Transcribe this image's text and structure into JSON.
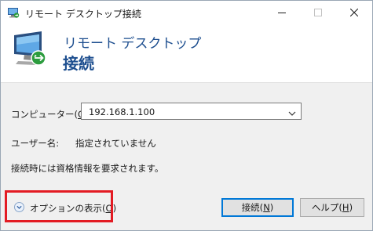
{
  "window": {
    "title": "リモート デスクトップ接続"
  },
  "banner": {
    "line1": "リモート デスクトップ",
    "line2": "接続"
  },
  "form": {
    "computer_label_pre": "コンピューター(",
    "computer_label_key": "C",
    "computer_label_post": "):",
    "computer_value": "192.168.1.100",
    "user_label": "ユーザー名:",
    "user_value": "指定されていません",
    "credentials_note": "接続時には資格情報を要求されます。"
  },
  "options": {
    "label_pre": "オプションの表示(",
    "label_key": "O",
    "label_post": ")"
  },
  "buttons": {
    "connect_pre": "接続(",
    "connect_key": "N",
    "connect_post": ")",
    "help_pre": "ヘルプ(",
    "help_key": "H",
    "help_post": ")"
  },
  "colors": {
    "banner_text": "#1d4e8f",
    "highlight": "#e31b23",
    "default_button_border": "#0078d7"
  }
}
